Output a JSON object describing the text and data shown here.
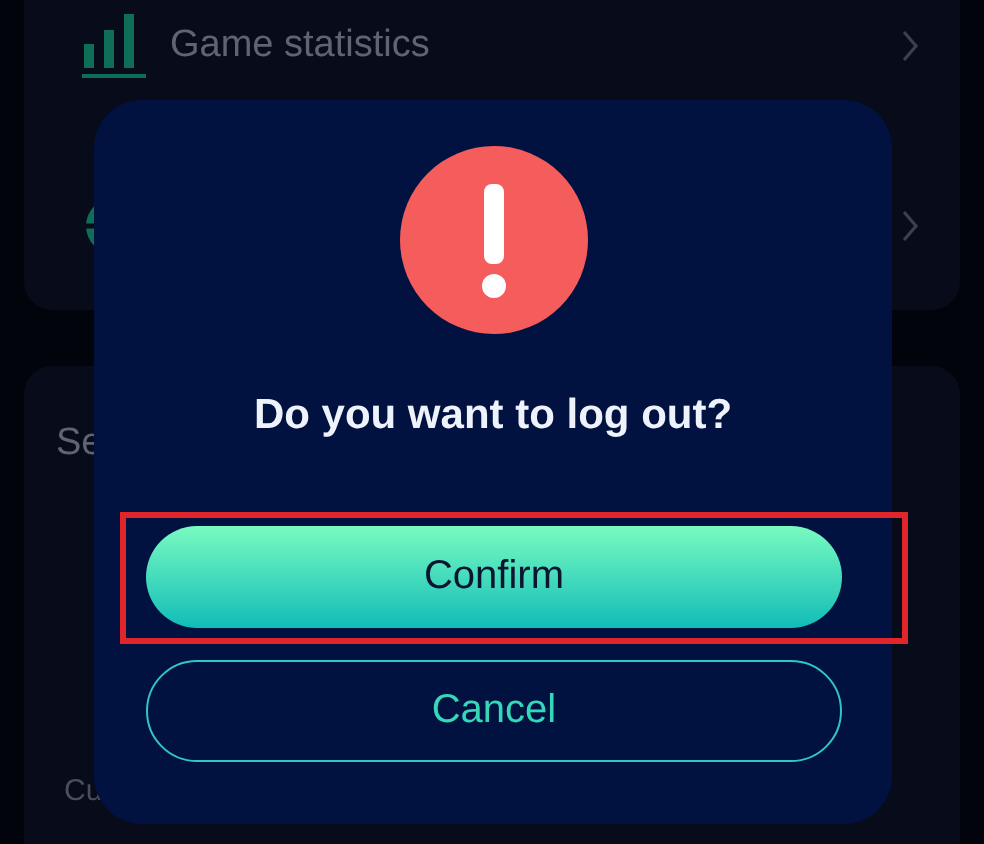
{
  "menu_card": {
    "items": [
      {
        "kind": "labeled",
        "label": "Game statistics"
      },
      {
        "kind": "covered"
      }
    ]
  },
  "settings_card": {
    "title": "Se",
    "row_label": "Cu"
  },
  "dialog": {
    "message": "Do you want to log out?",
    "buttons": [
      {
        "label": "Confirm",
        "kind": "primary",
        "highlighted": true
      },
      {
        "label": "Cancel",
        "kind": "outline",
        "highlighted": false
      }
    ]
  }
}
